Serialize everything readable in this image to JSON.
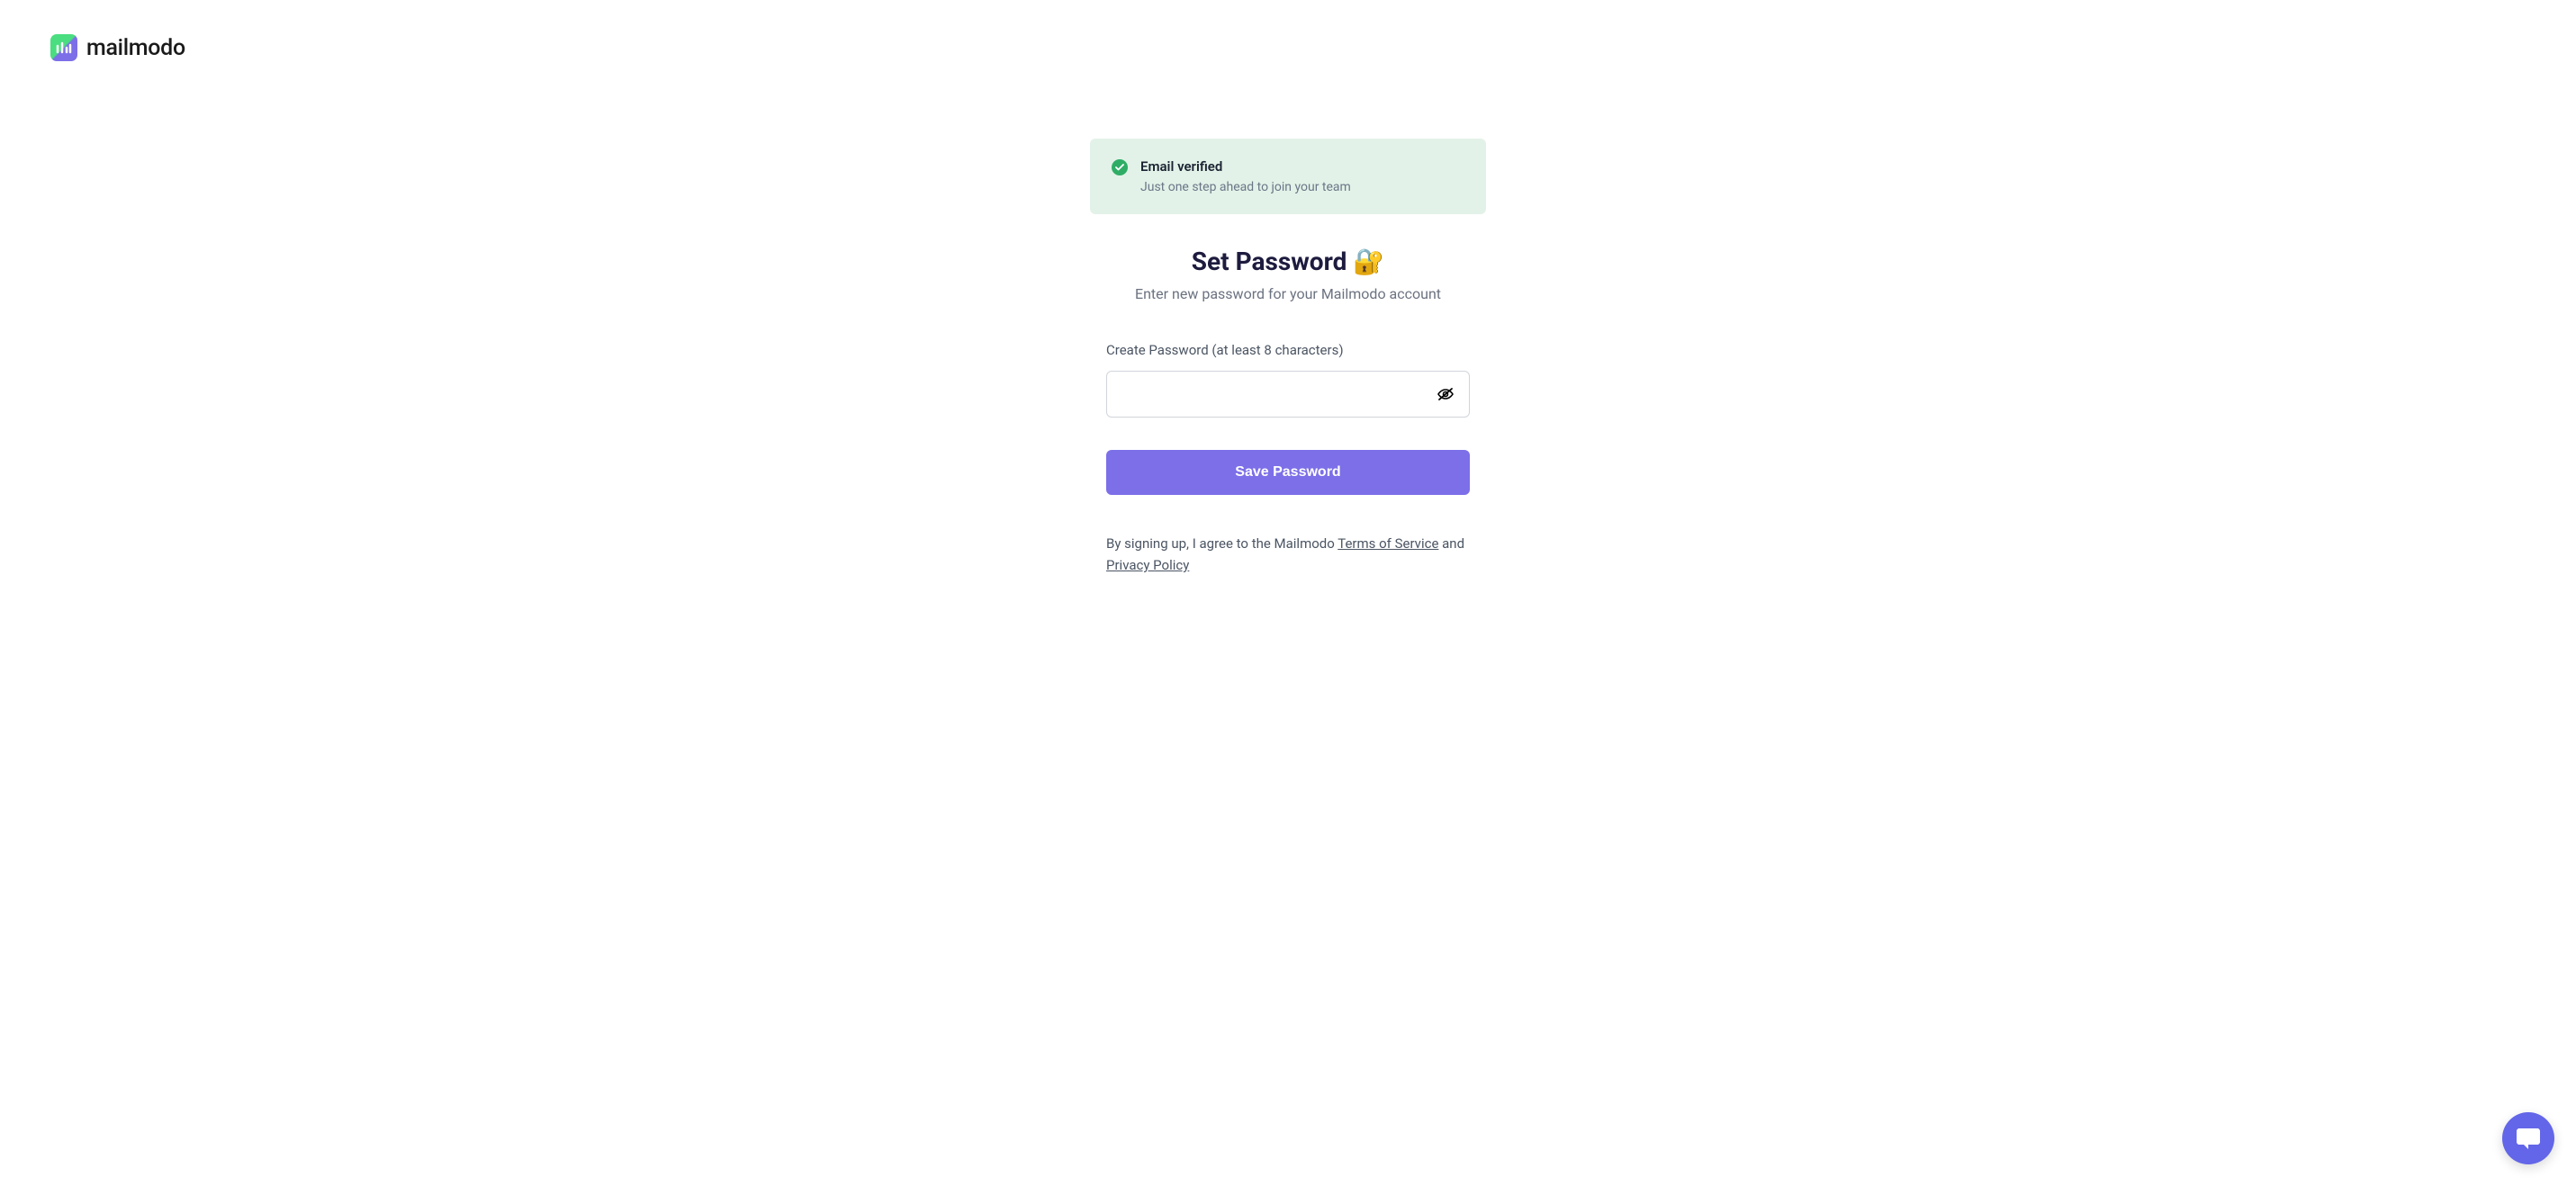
{
  "brand": {
    "name": "mailmodo"
  },
  "alert": {
    "title": "Email verified",
    "subtitle": "Just one step ahead to join your team"
  },
  "page": {
    "title": "Set Password 🔐",
    "subtitle": "Enter new password for your Mailmodo account"
  },
  "form": {
    "password_label": "Create Password (at least 8 characters)",
    "password_value": "",
    "save_button": "Save Password"
  },
  "terms": {
    "prefix": "By signing up, I agree to the Mailmodo ",
    "tos_link": "Terms of Service",
    "connector": " and ",
    "privacy_link": "Privacy Policy"
  }
}
